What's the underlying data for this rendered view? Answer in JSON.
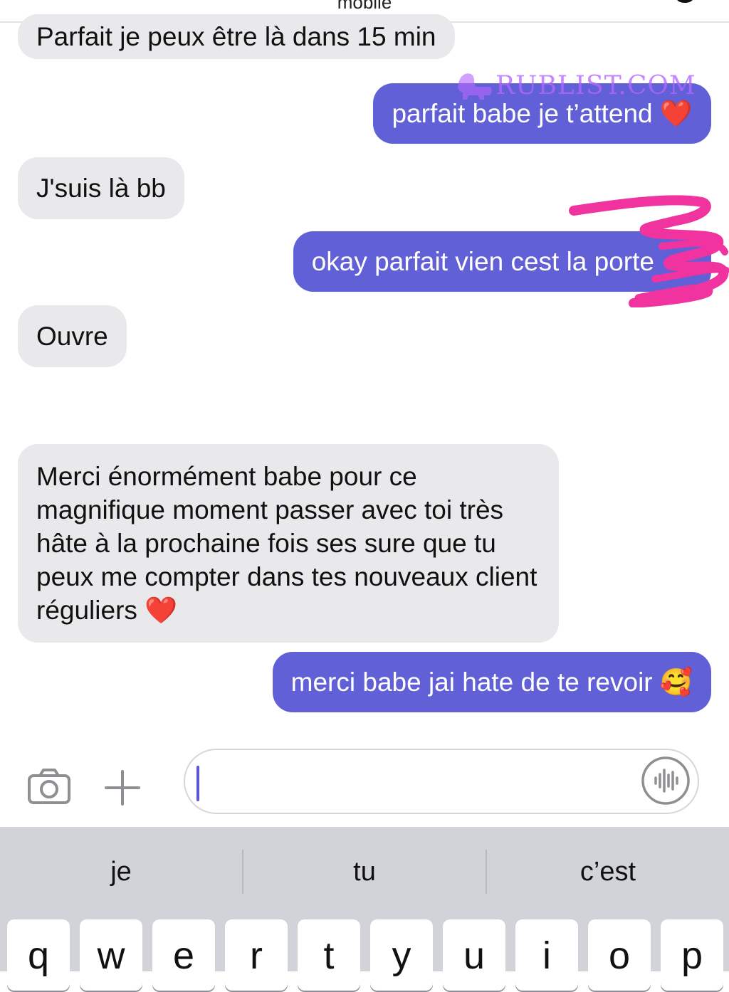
{
  "header": {
    "title": "mobile"
  },
  "messages": [
    {
      "from": "them",
      "text": "Parfait je peux être là dans 15 min"
    },
    {
      "from": "me",
      "text": "parfait babe je t’attend",
      "emoji": "❤️"
    },
    {
      "from": "them",
      "text": "J'suis là bb"
    },
    {
      "from": "me",
      "text": "okay parfait vien cest la porte"
    },
    {
      "from": "them",
      "text": "Ouvre"
    },
    {
      "from": "them",
      "text": "Merci énormément babe pour ce magnifique moment passer avec toi très hâte à la prochaine fois ses sure que tu peux me compter dans tes nouveaux client réguliers",
      "emoji": "❤️"
    },
    {
      "from": "me",
      "text": "merci babe jai hate de te revoir",
      "emoji": "🥰"
    }
  ],
  "watermark": {
    "text": "RUBLIST.COM"
  },
  "composer": {
    "input_value": "",
    "icons": [
      "camera-icon",
      "plus-icon",
      "voice-waveform-icon"
    ]
  },
  "keyboard": {
    "suggestions": [
      "je",
      "tu",
      "c’est"
    ],
    "top_row": [
      "q",
      "w",
      "e",
      "r",
      "t",
      "y",
      "u",
      "i",
      "o",
      "p"
    ]
  },
  "colors": {
    "outgoing_bubble": "#6260d6",
    "incoming_bubble": "#e9e9eb",
    "keyboard_bg": "#d1d3d9",
    "redaction_scribble": "#f0339f",
    "watermark": "#b566ff"
  }
}
